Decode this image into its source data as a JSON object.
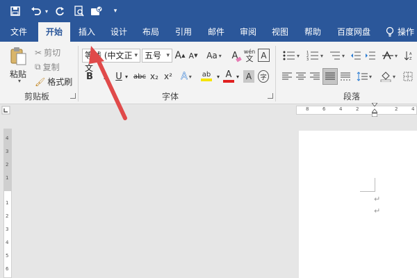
{
  "qat": {
    "icons": [
      "save-icon",
      "undo-icon",
      "undo-dropdown-icon",
      "redo-icon",
      "print-preview-icon",
      "touch-mode-icon",
      "customize-qat-icon"
    ]
  },
  "tabs": [
    "文件",
    "开始",
    "插入",
    "设计",
    "布局",
    "引用",
    "邮件",
    "审阅",
    "视图",
    "帮助",
    "百度网盘",
    "操作"
  ],
  "active_tab": "开始",
  "clipboard": {
    "paste_label": "粘贴",
    "cut_label": "剪切",
    "copy_label": "复制",
    "format_painter_label": "格式刷",
    "group_label": "剪贴板"
  },
  "font": {
    "font_name": "等线 (中文正文",
    "font_size": "五号",
    "grow_label": "A",
    "shrink_label": "A",
    "case_label": "Aa",
    "clear_label": "A",
    "phonetic_label": "wén",
    "phonetic_sub": "文",
    "border_label": "A",
    "bold_label": "B",
    "italic_label": "I",
    "underline_label": "U",
    "strike_label": "abc",
    "subscript_label": "x₂",
    "superscript_label": "x²",
    "effects_label": "A",
    "highlight_label": "ab",
    "color_label": "A",
    "shading_label": "A",
    "enclose_label": "字",
    "group_label": "字体"
  },
  "paragraph": {
    "group_label": "段落"
  },
  "ruler": {
    "h_numbers": [
      "8",
      "6",
      "4",
      "2",
      "2",
      "4"
    ],
    "v_numbers": [
      "4",
      "3",
      "2",
      "1",
      "1",
      "2",
      "3",
      "4",
      "5",
      "6"
    ]
  },
  "colors": {
    "accent": "#2b579a",
    "ribbon": "#f3f3f3",
    "canvas": "#e6e6e6",
    "arrow": "#e04a4a",
    "font_color": "#e02020",
    "highlight": "#f5e400"
  }
}
